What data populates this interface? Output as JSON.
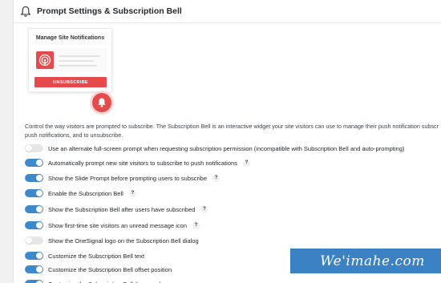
{
  "header": {
    "title": "Prompt Settings & Subscription Bell",
    "icon": "bell-icon"
  },
  "preview": {
    "title": "Manage Site Notifications",
    "button_label": "UNSUBSCRIBE",
    "accent": "#e54b4d"
  },
  "description": {
    "line1": "Control the way visitors are prompted to subscribe. The Subscription Bell is an interactive widget your site visitors can use to manage their push notification subscr",
    "line2": "push notifications, and to unsubscribe."
  },
  "settings": [
    {
      "label": "Use an alternate full-screen prompt when requesting subscription permission (incompatible with Subscription Bell and auto-prompting)",
      "enabled": false,
      "help": ""
    },
    {
      "label": "Automatically prompt new site visitors to subscribe to push notifications",
      "enabled": true,
      "help": "?"
    },
    {
      "label": "Show the Slide Prompt before prompting users to subscribe",
      "enabled": true,
      "help": "?"
    },
    {
      "label": "Enable the Subscription Bell",
      "enabled": true,
      "help": "?"
    },
    {
      "label": "Show the Subscription Bell after users have subscribed",
      "enabled": true,
      "help": "?"
    },
    {
      "label": "Show first-time site visitors an unread message icon",
      "enabled": true,
      "help": "?"
    },
    {
      "label": "Show the OneSignal logo on the Subscription Bell dialog",
      "enabled": false,
      "help": ""
    },
    {
      "label": "Customize the Subscription Bell text",
      "enabled": true,
      "help": ""
    },
    {
      "label": "Customize the Subscription Bell offset position",
      "enabled": true,
      "help": ""
    },
    {
      "label": "Customize the Subscription Bell theme colors",
      "enabled": true,
      "help": ""
    }
  ],
  "colors": {
    "toggle_on": "#3e89cc",
    "toggle_off": "#e6e6e6"
  },
  "watermark": {
    "text": "We'imahe.com"
  }
}
